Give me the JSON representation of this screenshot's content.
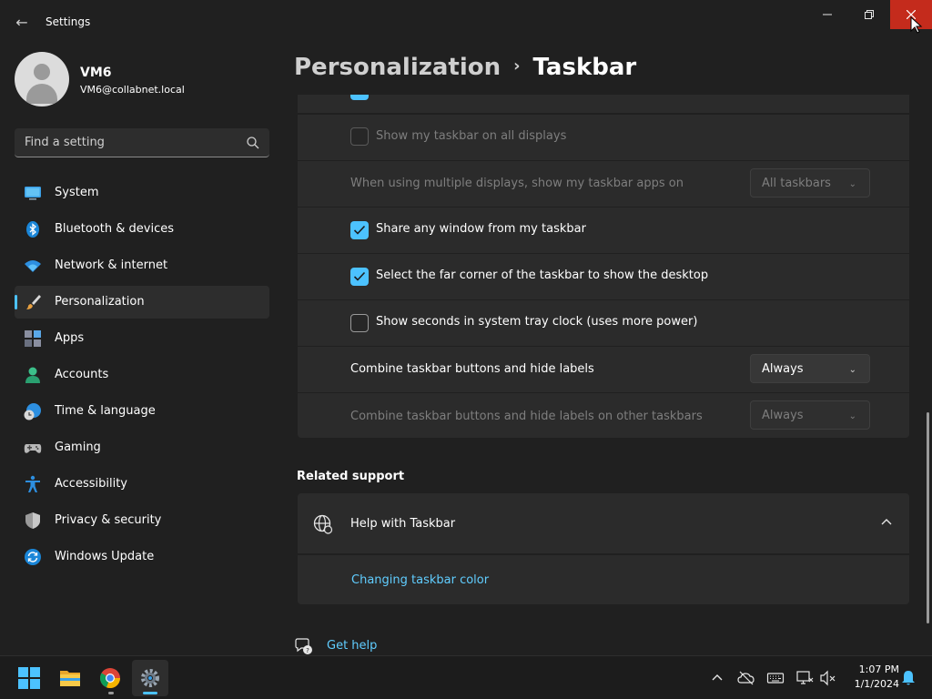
{
  "window": {
    "title": "Settings",
    "back_icon": "arrow-left-icon",
    "minimize_icon": "minimize-icon",
    "maximize_icon": "restore-icon",
    "close_icon": "close-icon",
    "close_color": "#c42b1c"
  },
  "profile": {
    "name": "VM6",
    "email": "VM6@collabnet.local"
  },
  "search": {
    "placeholder": "Find a setting",
    "icon": "search-icon"
  },
  "sidebar": {
    "items": [
      {
        "label": "System",
        "icon": "system-display-icon",
        "active": false
      },
      {
        "label": "Bluetooth & devices",
        "icon": "bluetooth-icon",
        "active": false
      },
      {
        "label": "Network & internet",
        "icon": "wifi-icon",
        "active": false
      },
      {
        "label": "Personalization",
        "icon": "paintbrush-icon",
        "active": true
      },
      {
        "label": "Apps",
        "icon": "apps-icon",
        "active": false
      },
      {
        "label": "Accounts",
        "icon": "person-icon",
        "active": false
      },
      {
        "label": "Time & language",
        "icon": "clock-globe-icon",
        "active": false
      },
      {
        "label": "Gaming",
        "icon": "gamepad-icon",
        "active": false
      },
      {
        "label": "Accessibility",
        "icon": "accessibility-icon",
        "active": false
      },
      {
        "label": "Privacy & security",
        "icon": "shield-icon",
        "active": false
      },
      {
        "label": "Windows Update",
        "icon": "update-sync-icon",
        "active": false
      }
    ],
    "accent": "#4cc2ff"
  },
  "breadcrumb": {
    "parent": "Personalization",
    "separator": "›",
    "current": "Taskbar"
  },
  "settings": {
    "show_on_all_displays": {
      "label": "Show my taskbar on all displays",
      "checked": false,
      "enabled": false
    },
    "multi_display_apps": {
      "label": "When using multiple displays, show my taskbar apps on",
      "value": "All taskbars",
      "enabled": false
    },
    "share_window": {
      "label": "Share any window from my taskbar",
      "checked": true,
      "enabled": true
    },
    "far_corner": {
      "label": "Select the far corner of the taskbar to show the desktop",
      "checked": true,
      "enabled": true
    },
    "show_seconds": {
      "label": "Show seconds in system tray clock (uses more power)",
      "checked": false,
      "enabled": true
    },
    "combine_buttons": {
      "label": "Combine taskbar buttons and hide labels",
      "value": "Always",
      "enabled": true
    },
    "combine_other": {
      "label": "Combine taskbar buttons and hide labels on other taskbars",
      "value": "Always",
      "enabled": false
    }
  },
  "related_support": {
    "title": "Related support",
    "help_title": "Help with Taskbar",
    "help_icon": "globe-icon",
    "expanded": true,
    "link": "Changing taskbar color"
  },
  "get_help": {
    "label": "Get help",
    "icon": "help-chat-icon"
  },
  "taskbar": {
    "apps": [
      {
        "name": "start",
        "icon": "windows-start-icon"
      },
      {
        "name": "file-explorer",
        "icon": "folder-icon"
      },
      {
        "name": "chrome",
        "icon": "chrome-icon"
      },
      {
        "name": "settings",
        "icon": "settings-gear-icon"
      }
    ],
    "tray": [
      "chevron-up-icon",
      "onedrive-off-icon",
      "keyboard-icon",
      "network-icon",
      "volume-muted-icon"
    ],
    "time": "1:07 PM",
    "date": "1/1/2024",
    "notification_icon": "bell-icon"
  }
}
